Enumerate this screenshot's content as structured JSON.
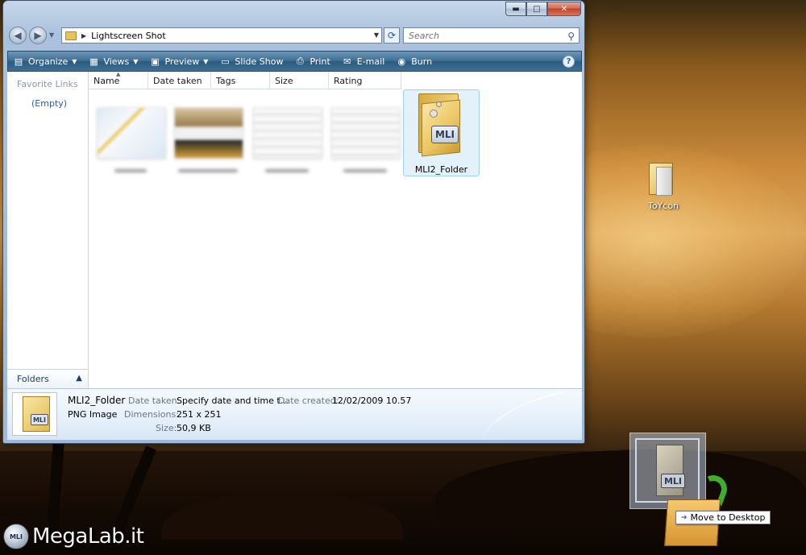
{
  "window": {
    "address": "Lightscreen Shot",
    "search_placeholder": "Search",
    "caption": {
      "minimize": "▬",
      "maximize": "□",
      "close": "✕"
    }
  },
  "toolbar": {
    "items": [
      {
        "label": "Organize",
        "icon": "organize-icon",
        "dropdown": true
      },
      {
        "label": "Views",
        "icon": "views-icon",
        "dropdown": true
      },
      {
        "label": "Preview",
        "icon": "preview-icon",
        "dropdown": true
      },
      {
        "label": "Slide Show",
        "icon": "slideshow-icon",
        "dropdown": false
      },
      {
        "label": "Print",
        "icon": "print-icon",
        "dropdown": false
      },
      {
        "label": "E-mail",
        "icon": "email-icon",
        "dropdown": false
      },
      {
        "label": "Burn",
        "icon": "burn-icon",
        "dropdown": false
      }
    ],
    "help": "?"
  },
  "nav_pane": {
    "heading": "Favorite Links",
    "empty": "(Empty)",
    "folders": "Folders"
  },
  "columns": [
    "Name",
    "Date taken",
    "Tags",
    "Size",
    "Rating"
  ],
  "files": {
    "selected_label": "MLI2_Folder",
    "badge": "MLI"
  },
  "details": {
    "name": "MLI2_Folder",
    "type": "PNG Image",
    "date_taken_label": "Date taken:",
    "date_taken_value": "Specify date and time t...",
    "date_created_label": "Date created:",
    "date_created_value": "12/02/2009 10.57",
    "dimensions_label": "Dimensions:",
    "dimensions_value": "251 x 251",
    "size_label": "Size:",
    "size_value": "50,9 KB"
  },
  "desktop": {
    "icon_label": "ToYcon",
    "tooltip": "Move to Desktop"
  },
  "watermark": {
    "logo_text": "MLI",
    "text": "MegaLab.it"
  }
}
